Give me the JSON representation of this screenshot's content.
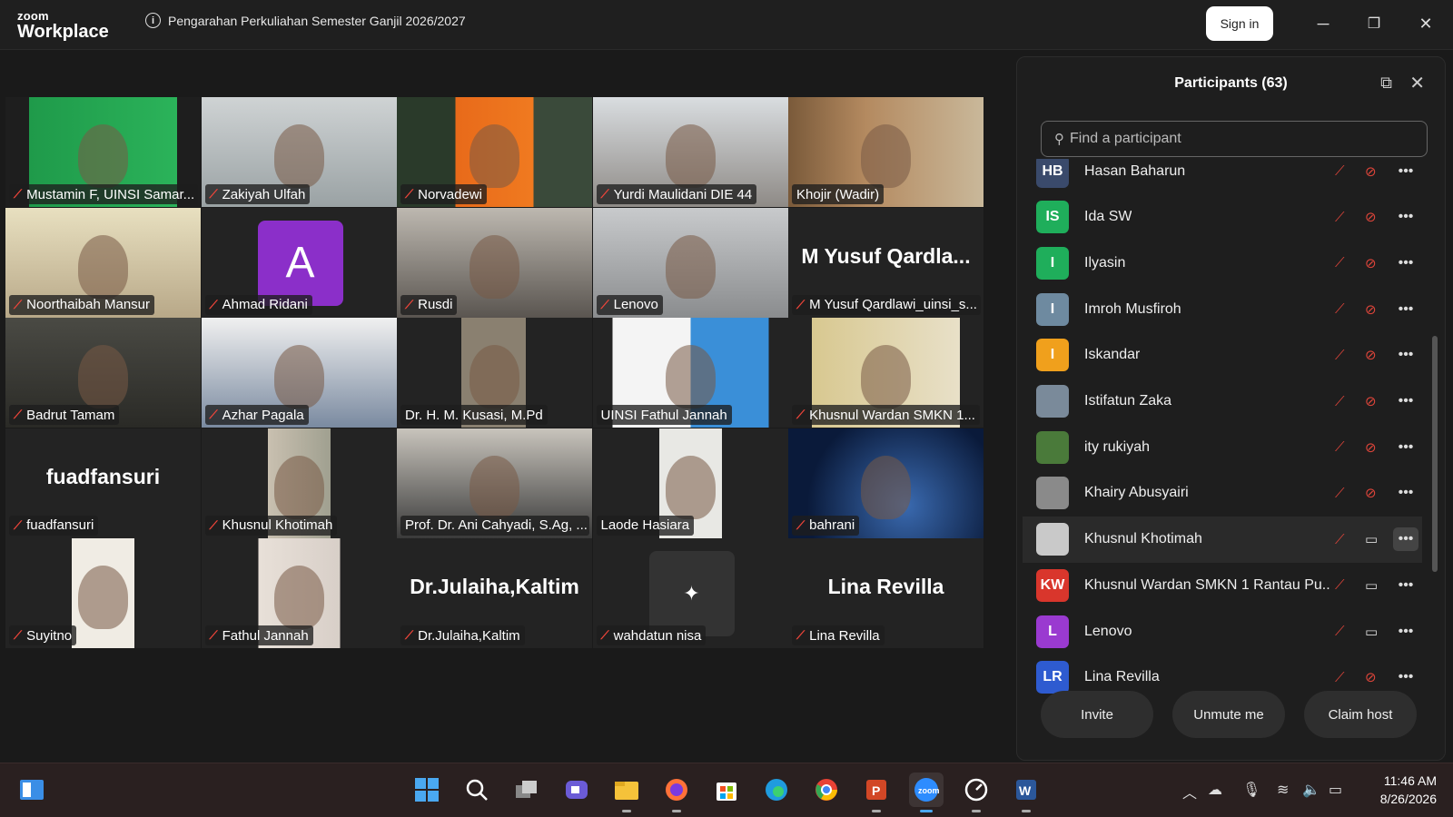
{
  "titlebar": {
    "logo_line1": "zoom",
    "logo_line2": "Workplace",
    "meeting_title": "Pengarahan Perkuliahan Semester Ganjil 2026/2027",
    "signin_label": "Sign in",
    "minimize": "─",
    "restore": "❐",
    "close": "✕"
  },
  "tiles": [
    {
      "name": "Mustamin F, UINSI Samar...",
      "muted": true
    },
    {
      "name": "Zakiyah Ulfah",
      "muted": true
    },
    {
      "name": "Norvadewi",
      "muted": true
    },
    {
      "name": "Yurdi Maulidani DIE 44",
      "muted": true
    },
    {
      "name": "Khojir (Wadir)",
      "muted": false
    },
    {
      "name": "Noorthaibah Mansur",
      "muted": true
    },
    {
      "name": "Ahmad Ridani",
      "muted": true,
      "avatar_letter": "A"
    },
    {
      "name": "Rusdi",
      "muted": true
    },
    {
      "name": "Lenovo",
      "muted": true
    },
    {
      "name": "M Yusuf Qardlawi_uinsi_s...",
      "muted": true,
      "big_text": "M Yusuf Qardla..."
    },
    {
      "name": "Badrut Tamam",
      "muted": true
    },
    {
      "name": "Azhar Pagala",
      "muted": true
    },
    {
      "name": "Dr. H. M. Kusasi, M.Pd",
      "muted": false
    },
    {
      "name": "UINSI Fathul Jannah",
      "muted": false
    },
    {
      "name": "Khusnul Wardan SMKN 1...",
      "muted": true
    },
    {
      "name": "fuadfansuri",
      "muted": true,
      "big_text": "fuadfansuri"
    },
    {
      "name": "Khusnul Khotimah",
      "muted": true
    },
    {
      "name": "Prof. Dr. Ani Cahyadi, S.Ag, ...",
      "muted": false
    },
    {
      "name": "Laode Hasiara",
      "muted": false
    },
    {
      "name": "bahrani",
      "muted": true
    },
    {
      "name": "Suyitno",
      "muted": true
    },
    {
      "name": "Fathul Jannah",
      "muted": true
    },
    {
      "name": "Dr.Julaiha,Kaltim",
      "muted": true,
      "big_text": "Dr.Julaiha,Kaltim"
    },
    {
      "name": "wahdatun nisa",
      "muted": true
    },
    {
      "name": "Lina Revilla",
      "muted": true,
      "big_text": "Lina Revilla"
    }
  ],
  "panel": {
    "title": "Participants (63)",
    "search_placeholder": "Find a participant",
    "participants": [
      {
        "initials": "HB",
        "name": "Hasan Baharun",
        "color": "#3a4a6b",
        "video_on": false
      },
      {
        "initials": "IS",
        "name": "Ida SW",
        "color": "#1fae5b",
        "video_on": false
      },
      {
        "initials": "I",
        "name": "Ilyasin",
        "color": "#1fae5b",
        "video_on": false
      },
      {
        "initials": "I",
        "name": "Imroh Musfiroh",
        "color": "#6e8aa0",
        "video_on": false
      },
      {
        "initials": "I",
        "name": "Iskandar",
        "color": "#f0a01c",
        "video_on": false
      },
      {
        "initials": "",
        "name": "Istifatun Zaka",
        "color": "#7a8a9a",
        "video_on": false
      },
      {
        "initials": "",
        "name": "ity rukiyah",
        "color": "#4a7a3a",
        "video_on": false
      },
      {
        "initials": "",
        "name": "Khairy Abusyairi",
        "color": "#8a8a8a",
        "video_on": false
      },
      {
        "initials": "",
        "name": "Khusnul Khotimah",
        "color": "#c9c9c9",
        "video_on": true
      },
      {
        "initials": "KW",
        "name": "Khusnul Wardan SMKN 1 Rantau Pu...",
        "color": "#d9362c",
        "video_on": true
      },
      {
        "initials": "L",
        "name": "Lenovo",
        "color": "#9a3ad0",
        "video_on": true
      },
      {
        "initials": "LR",
        "name": "Lina Revilla",
        "color": "#2e5bd0",
        "video_on": false
      }
    ],
    "buttons": {
      "invite": "Invite",
      "unmute": "Unmute me",
      "claim": "Claim host"
    }
  },
  "taskbar": {
    "time": "11:46 AM",
    "date": "8/26/2026"
  }
}
